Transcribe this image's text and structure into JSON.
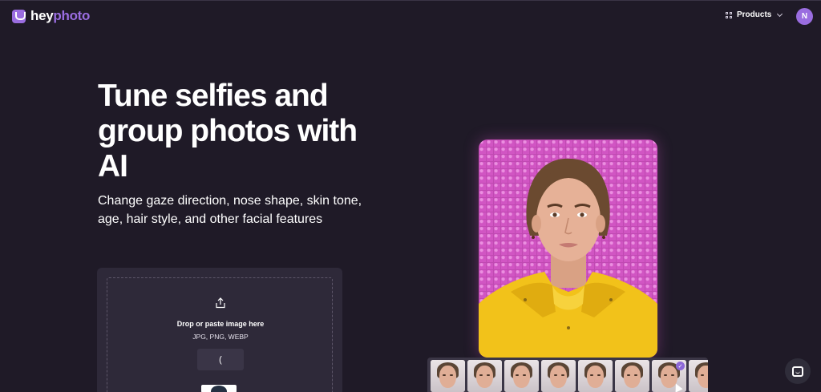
{
  "header": {
    "logo_part1": "hey",
    "logo_part2": "photo",
    "products_label": "Products",
    "avatar_initial": "N",
    "icons": [
      "logo-hand-icon",
      "grid-icon",
      "chevron-down-icon"
    ]
  },
  "hero": {
    "title": "Tune selfies and group photos with AI",
    "subtitle": "Change gaze direction, nose shape, skin tone, age, hair style, and other facial features"
  },
  "upload": {
    "title": "Drop or paste image here",
    "formats": "JPG, PNG, WEBP",
    "button_label": "(",
    "icons": [
      "upload-icon"
    ]
  },
  "thumbnails": {
    "count": 8,
    "selected_index": 6,
    "selected_icon": "check-icon"
  },
  "chat": {
    "icon": "chat-icon"
  },
  "colors": {
    "background": "#1f1a27",
    "accent": "#9a6de0",
    "portrait_bg": "#d155c3",
    "jacket": "#f2c21a"
  }
}
